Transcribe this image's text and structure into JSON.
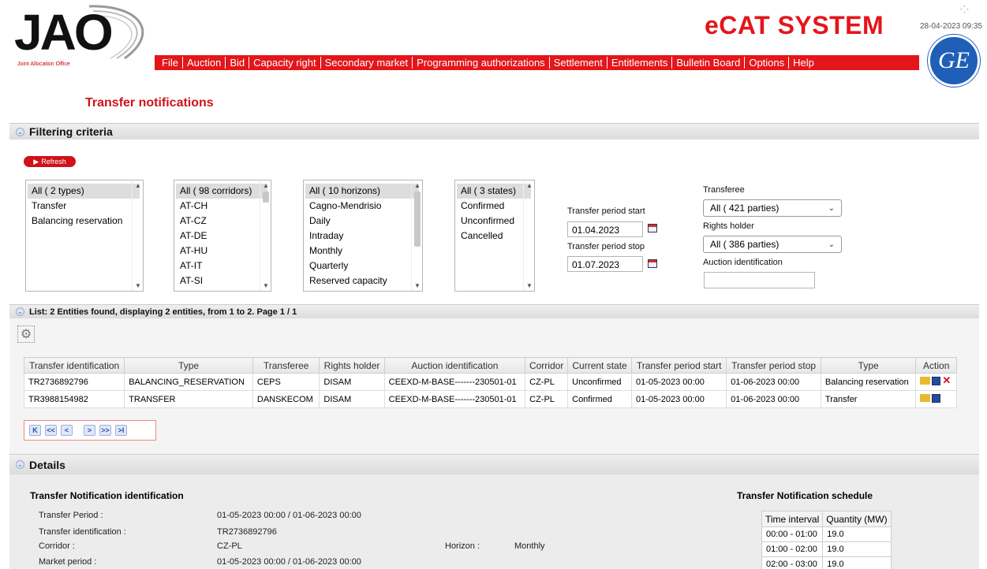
{
  "header": {
    "logo_text": "JAO",
    "logo_subtitle": "Joint Allocation Office",
    "brand": "eCAT SYSTEM",
    "timestamp": "28-04-2023 09:35",
    "ge_logo_text": "GE"
  },
  "menu": [
    "File",
    "Auction",
    "Bid",
    "Capacity right",
    "Secondary market",
    "Programming authorizations",
    "Settlement",
    "Entitlements",
    "Bulletin Board",
    "Options",
    "Help"
  ],
  "page_title": "Transfer notifications",
  "filtering": {
    "section_title": "Filtering criteria",
    "refresh_label": "Refresh",
    "types": [
      "All ( 2 types)",
      "Transfer",
      "Balancing reservation"
    ],
    "corridors": [
      "All ( 98 corridors)",
      "AT-CH",
      "AT-CZ",
      "AT-DE",
      "AT-HU",
      "AT-IT",
      "AT-SI"
    ],
    "horizons": [
      "All ( 10 horizons)",
      "Cagno-Mendrisio",
      "Daily",
      "Intraday",
      "Monthly",
      "Quarterly",
      "Reserved capacity"
    ],
    "states": [
      "All ( 3 states)",
      "Confirmed",
      "Unconfirmed",
      "Cancelled"
    ],
    "period_start_label": "Transfer period start",
    "period_start_value": "01.04.2023",
    "period_stop_label": "Transfer period stop",
    "period_stop_value": "01.07.2023",
    "transferee_label": "Transferee",
    "transferee_value": "All ( 421 parties)",
    "rights_holder_label": "Rights holder",
    "rights_holder_value": "All ( 386 parties)",
    "auction_id_label": "Auction identification",
    "auction_id_value": ""
  },
  "list": {
    "section_title": "List: 2 Entities found, displaying 2 entities, from 1 to 2. Page 1 / 1",
    "columns": [
      "Transfer identification",
      "Type",
      "Transferee",
      "Rights holder",
      "Auction identification",
      "Corridor",
      "Current state",
      "Transfer period start",
      "Transfer period stop",
      "Type",
      "Action"
    ],
    "rows": [
      [
        "TR2736892796",
        "BALANCING_RESERVATION",
        "CEPS",
        "DISAM",
        "CEEXD-M-BASE-------230501-01",
        "CZ-PL",
        "Unconfirmed",
        "01-05-2023 00:00",
        "01-06-2023 00:00",
        "Balancing reservation"
      ],
      [
        "TR3988154982",
        "TRANSFER",
        "DANSKECOM",
        "DISAM",
        "CEEXD-M-BASE-------230501-01",
        "CZ-PL",
        "Confirmed",
        "01-05-2023 00:00",
        "01-06-2023 00:00",
        "Transfer"
      ]
    ],
    "pager": [
      "K",
      "<<",
      "<",
      ">",
      ">>",
      ">I"
    ]
  },
  "details": {
    "section_title": "Details",
    "id_title": "Transfer Notification identification",
    "transfer_period_label": "Transfer Period :",
    "transfer_period_value": "01-05-2023 00:00 / 01-06-2023 00:00",
    "transfer_id_label": "Transfer identification :",
    "transfer_id_value": "TR2736892796",
    "corridor_label": "Corridor :",
    "corridor_value": "CZ-PL",
    "horizon_label": "Horizon :",
    "horizon_value": "Monthly",
    "market_period_label": "Market period :",
    "market_period_value": "01-05-2023 00:00 / 01-06-2023 00:00",
    "schedule_title": "Transfer Notification schedule",
    "schedule_columns": [
      "Time interval",
      "Quantity (MW)"
    ],
    "schedule_rows": [
      [
        "00:00 - 01:00",
        "19.0"
      ],
      [
        "01:00 - 02:00",
        "19.0"
      ],
      [
        "02:00 - 03:00",
        "19.0"
      ]
    ]
  },
  "colors": {
    "brand_red": "#e3161b",
    "title_red": "#d0121b",
    "ge_blue": "#1f5fb8"
  }
}
